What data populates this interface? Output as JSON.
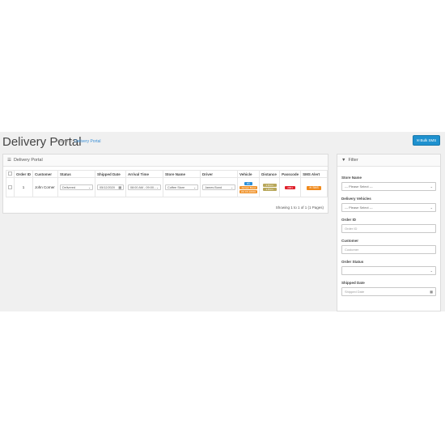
{
  "header": {
    "title": "Delivery Portal",
    "breadcrumb": [
      "Home",
      "Delivery Portal"
    ],
    "breadcrumb_sep": "›",
    "bulk_sms_label": "Bulk SMS"
  },
  "main_panel": {
    "title": "Delivery Portal",
    "columns": [
      "Order ID",
      "Customer",
      "Status",
      "Shipped Date",
      "Arrival Time",
      "Store Name",
      "Driver",
      "Vehicle",
      "Distance",
      "Passcode",
      "SMS Alert"
    ],
    "rows": [
      {
        "order_id": "1",
        "customer": "John Corner",
        "status": "Delivered",
        "shipped_date": "05/12/2020",
        "arrival_time": "08:00 AM - 09:00...",
        "store_name": "Coffee Store",
        "driver": "James Bond",
        "vehicle_badge": "#1",
        "vehicle_tag1": "Jensen Bond",
        "vehicle_tag2": "ZZ-XX-10001",
        "distance1": "1.8 km",
        "distance2": "1.8 km",
        "passcode": "2961",
        "sms": "SMS"
      }
    ],
    "showing": "Showing 1 to 1 of 1 (1 Pages)"
  },
  "filter": {
    "title": "Filter",
    "store_name_label": "Store Name",
    "store_name_value": "--- Please Select ---",
    "delivery_vehicles_label": "Delivery Vehicles",
    "delivery_vehicles_value": "--- Please Select ---",
    "order_id_label": "Order ID",
    "order_id_placeholder": "Order ID",
    "customer_label": "Customer",
    "customer_placeholder": "Customer",
    "order_status_label": "Order Status",
    "order_status_value": "",
    "shipped_date_label": "Shipped Date",
    "shipped_date_placeholder": "Shipped Date"
  },
  "colors": {
    "primary": "#1e91cf",
    "sms_orange": "#f08a1c",
    "passcode_red": "#e0202b",
    "distance_olive": "#b8a75a"
  }
}
